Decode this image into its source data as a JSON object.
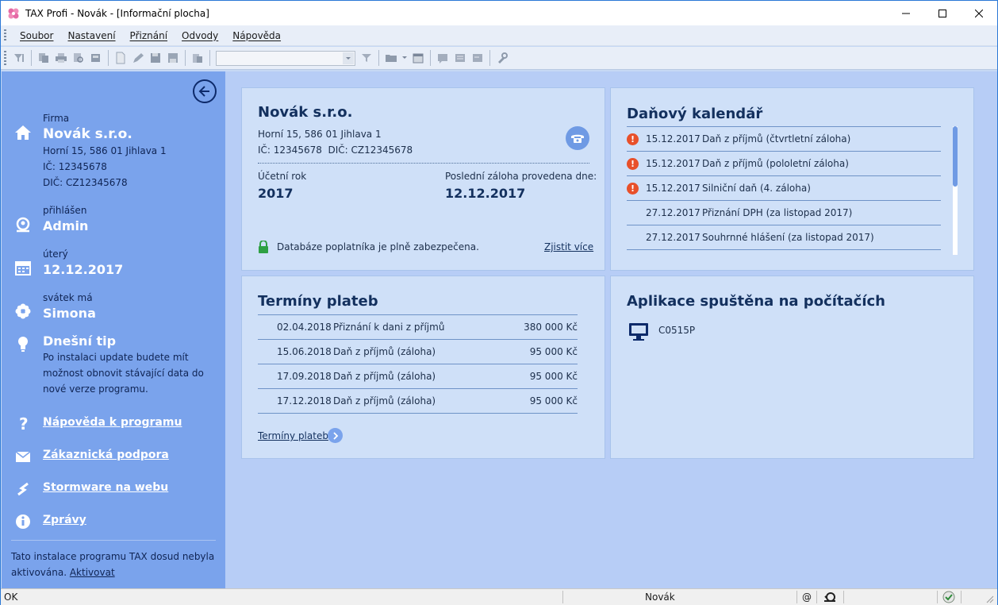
{
  "window": {
    "title": "TAX Profi - Novák - [Informační plocha]"
  },
  "menu": {
    "items": [
      "Soubor",
      "Nastavení",
      "Přiznání",
      "Odvody",
      "Nápověda"
    ]
  },
  "toolbar": {
    "combo_value": ""
  },
  "sidebar": {
    "firma_label": "Firma",
    "firma_name": "Novák s.r.o.",
    "firma_address": "Horní 15, 586 01 Jihlava 1",
    "firma_ic": "IČ: 12345678",
    "firma_dic": "DIČ: CZ12345678",
    "user_label": "přihlášen",
    "user_name": "Admin",
    "day_label": "úterý",
    "date": "12.12.2017",
    "svatek_label": "svátek má",
    "svatek_name": "Simona",
    "tip_title": "Dnešní tip",
    "tip_lines": [
      "Po instalaci update budete mít",
      "možnost obnovit stávající data do",
      "nové verze programu."
    ],
    "links": [
      "Nápověda k programu",
      "Zákaznická podpora",
      "Stormware na webu",
      "Zprávy"
    ],
    "activation_text": "Tato instalace programu TAX dosud nebyla",
    "activation_text2": "aktivována.",
    "activation_link": "Aktivovat"
  },
  "company": {
    "name": "Novák s.r.o.",
    "address": "Horní 15, 586 01 Jihlava 1",
    "ids": "IČ: 12345678  DIČ: CZ12345678",
    "year_label": "Účetní rok",
    "year": "2017",
    "last_label": "Poslední záloha provedena dne:",
    "last_date": "12.12.2017",
    "security_text": "Databáze poplatníka je plně zabezpečena.",
    "security_link": "Zjistit více"
  },
  "calendar": {
    "title": "Daňový kalendář",
    "rows": [
      {
        "date": "15.12.2017",
        "text": "Daň z příjmů (čtvrtletní záloha)",
        "alert": true
      },
      {
        "date": "15.12.2017",
        "text": "Daň z příjmů (pololetní záloha)",
        "alert": true
      },
      {
        "date": "15.12.2017",
        "text": "Silniční daň (4. záloha)",
        "alert": true
      },
      {
        "date": "27.12.2017",
        "text": "Přiznání DPH (za listopad 2017)",
        "alert": false
      },
      {
        "date": "27.12.2017",
        "text": "Souhrnné hlášení (za listopad 2017)",
        "alert": false
      }
    ]
  },
  "payments": {
    "title": "Termíny plateb",
    "rows": [
      {
        "date": "02.04.2018",
        "text": "Přiznání k dani z příjmů",
        "amount": "380 000 Kč"
      },
      {
        "date": "15.06.2018",
        "text": "Daň z příjmů (záloha)",
        "amount": "95 000 Kč"
      },
      {
        "date": "17.09.2018",
        "text": "Daň z příjmů (záloha)",
        "amount": "95 000 Kč"
      },
      {
        "date": "17.12.2018",
        "text": "Daň z příjmů (záloha)",
        "amount": "95 000 Kč"
      }
    ],
    "link": "Termíny plateb"
  },
  "computers": {
    "title": "Aplikace spuštěna na počítačích",
    "items": [
      "C0515P"
    ]
  },
  "status": {
    "left": "OK",
    "user": "Novák",
    "at": "@"
  },
  "colors": {
    "sidebar": "#7aa3ec",
    "main": "#b7cdf6",
    "panel": "#cfe0f8",
    "accent": "#13305e",
    "alert": "#e8502a"
  }
}
